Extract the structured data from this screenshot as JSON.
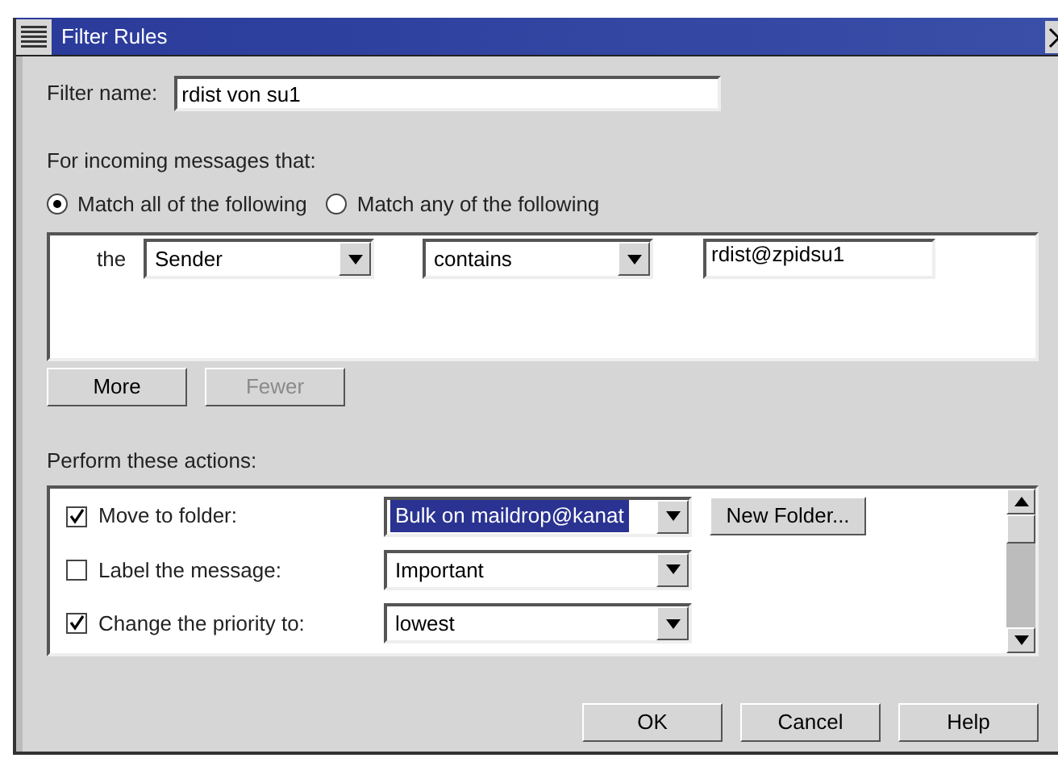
{
  "window": {
    "title": "Filter Rules"
  },
  "filter_name": {
    "label": "Filter name:",
    "value": "rdist von su1"
  },
  "incoming": {
    "label": "For incoming messages that:",
    "options": [
      {
        "label": "Match all of the following",
        "selected": true
      },
      {
        "label": "Match any of the following",
        "selected": false
      }
    ]
  },
  "conditions": [
    {
      "prefix": "the",
      "field": "Sender",
      "operator": "contains",
      "value": "rdist@zpidsu1"
    }
  ],
  "condition_buttons": [
    {
      "label": "More",
      "disabled": false
    },
    {
      "label": "Fewer",
      "disabled": true
    }
  ],
  "actions_label": "Perform these actions:",
  "actions": [
    {
      "label": "Move to folder:",
      "checked": true,
      "value": "Bulk on maildrop@kanat",
      "highlighted": true,
      "extra_button": "New Folder..."
    },
    {
      "label": "Label the message:",
      "checked": false,
      "value": "Important",
      "highlighted": false
    },
    {
      "label": "Change the priority to:",
      "checked": true,
      "value": "lowest",
      "highlighted": false
    }
  ],
  "buttons": [
    "OK",
    "Cancel",
    "Help"
  ]
}
